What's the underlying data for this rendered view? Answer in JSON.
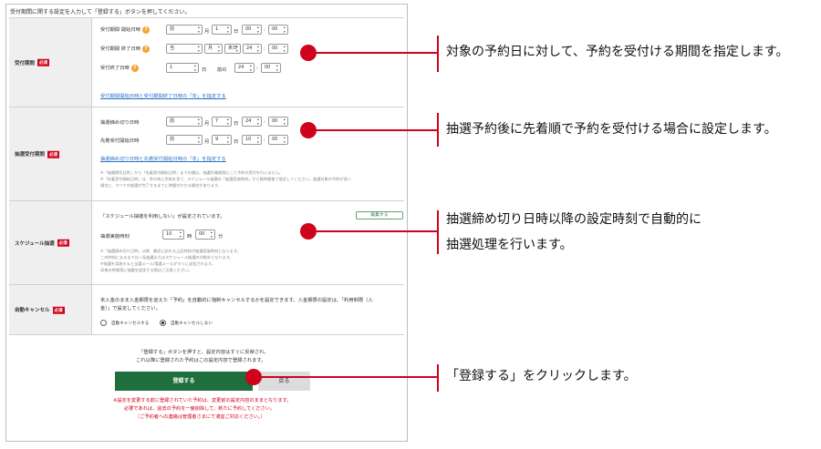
{
  "intro": "受付期間に関する設定を入力して「登録する」ボタンを押してください。",
  "required_badge": "必須",
  "reception": {
    "label": "受付期間",
    "start_label": "受付期間 開始日時",
    "start": {
      "sel1": "前",
      "month": "1",
      "day": "1",
      "hour": "00",
      "minute": "00"
    },
    "end_label": "受付期間 終了日時",
    "end": {
      "sel1": "当",
      "month": "月",
      "day": "末日",
      "hour": "24",
      "minute": "00"
    },
    "close_label": "受付終了日時",
    "close": {
      "days": "1",
      "hour": "24",
      "minute": "00"
    },
    "link": "受付期間開始日時と受付期間終了日時の「年」を指定する",
    "u_month": "月",
    "u_day": "日",
    "u_colon": ":",
    "u_before": "前の"
  },
  "lottery": {
    "label": "抽選受付期間",
    "deadline_label": "抽選締め切り日時",
    "deadline": {
      "sel1": "前",
      "month": "7",
      "day": "24",
      "minute": "00"
    },
    "first_label": "先着受付開始日時",
    "first": {
      "sel1": "前",
      "month": "9",
      "day": "10",
      "minute": "00"
    },
    "link": "抽選締め切り日時と先着受付開始日時の「年」を指定する",
    "note1": "※「抽選締切日時」から「先着受付開始日時」までの間は、抽選作業期間として予約の受付を行いません。",
    "note2": "※「先着受付開始日時」は、余の為に余裕を見て、スケジュール抽選の「抽選実施時刻」から数時間後で設定してください。抽選対象の予約が多い",
    "note3": "場合に、すべての抽選が完了するまでに時間がかかる場合があります。"
  },
  "schedule": {
    "label": "スケジュール抽選",
    "status": "「スケジュール抽選を利用しない」が設定されています。",
    "edit_button": "編集する",
    "time_label": "抽選実施時刻",
    "hour": "10",
    "u_hour": "時",
    "minute": "00",
    "u_min": "分",
    "note1": "※「抽選締め切り日時」以降、最初に訪れる上記時刻が抽選実施時刻となります。",
    "note2": "この時刻になるまでは一括抽選またはスケジュール抽選の対象外となります。",
    "note3": "※抽選を実施すると当選メール/落選メールがすぐに送信されます。",
    "note4": "深夜の時間帯に抽選を設定する際はご注意ください。"
  },
  "auto_cancel": {
    "label": "自動キャンセル",
    "desc1": "未入金のまま入金期限を迎えた「予約」を自動的に強制キャンセルするかを設定できます。入金期限の設定は、「利用制限（入",
    "desc2": "金）」で設定してください。",
    "opt_on": "自動キャンセルする",
    "opt_off": "自動キャンセルしない"
  },
  "footer": {
    "msg1": "「登録する」ボタンを押すと、設定内容はすぐに反映され、",
    "msg2": "これ以降に登録された予約はこの設定内容で登録されます。",
    "register_button": "登録する",
    "back_button": "戻る",
    "warn1": "※設定を変更する前に登録されていた予約は、変更前の設定内容のままとなります。",
    "warn2": "必要であれば、過去の予約を一度削除して、新たに予約してください。",
    "warn3": "（ご予約者への連絡は管理者さまにて適宜ご対応ください。）"
  },
  "callouts": {
    "c1": "対象の予約日に対して、予約を受付ける期間を指定します。",
    "c2": "抽選予約後に先着順で予約を受付ける場合に設定します。",
    "c3a": "抽選締め切り日時以降の設定時刻で自動的に",
    "c3b": "抽選処理を行います。",
    "c4": "「登録する」をクリックします。"
  },
  "colors": {
    "accent": "#d0021b",
    "register": "#1e6e3e",
    "link": "#2a73c8"
  }
}
